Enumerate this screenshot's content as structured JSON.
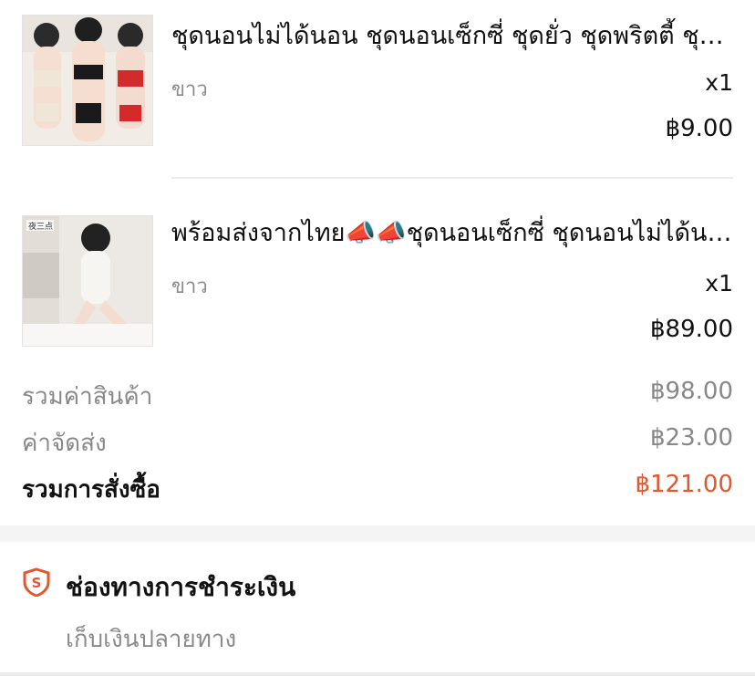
{
  "items": [
    {
      "name": "ชุดนอนไม่ได้นอน ชุดนอนเซ็กซี่ ชุดยั่ว ชุดพริตตี้ ชุดนอน ชุดชั้นใน",
      "variant": "ขาว",
      "qty": "x1",
      "price": "฿9.00",
      "thumb_icon": "lingerie-photo"
    },
    {
      "name": "พร้อมส่งจากไทย📣📣ชุดนอนเซ็กซี่ ชุดนอนไม่ได้นอน บอดี้สูท",
      "variant": "ขาว",
      "qty": "x1",
      "price": "฿89.00",
      "thumb_icon": "bodysuit-photo"
    }
  ],
  "summary": {
    "subtotal_label": "รวมค่าสินค้า",
    "subtotal_value": "฿98.00",
    "shipping_label": "ค่าจัดส่ง",
    "shipping_value": "฿23.00",
    "total_label": "รวมการสั่งซื้อ",
    "total_value": "฿121.00"
  },
  "payment": {
    "title": "ช่องทางการชำระเงิน",
    "method": "เก็บเงินปลายทาง",
    "icon": "shield-s-icon"
  },
  "colors": {
    "accent": "#e4572e",
    "muted_text": "#888888"
  }
}
